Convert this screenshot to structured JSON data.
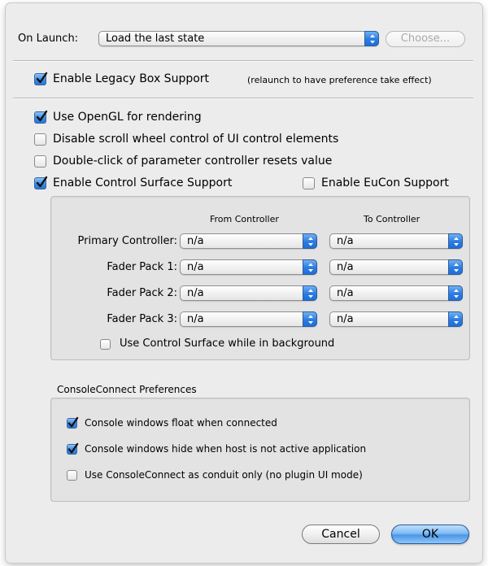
{
  "launch": {
    "label": "On Launch:",
    "selected": "Load the last state",
    "choose_label": "Choose..."
  },
  "legacy": {
    "label": "Enable Legacy Box Support",
    "note": "(relaunch to have preference take effect)",
    "checked": true
  },
  "options": [
    {
      "label": "Use OpenGL for rendering",
      "checked": true
    },
    {
      "label": "Disable scroll wheel control of UI control elements",
      "checked": false
    },
    {
      "label": "Double-click of parameter controller resets value",
      "checked": false
    },
    {
      "label": "Enable Control Surface Support",
      "checked": true
    }
  ],
  "eucon": {
    "label": "Enable EuCon Support",
    "checked": false
  },
  "controllers": {
    "from_header": "From Controller",
    "to_header": "To Controller",
    "rows": [
      {
        "label": "Primary Controller:",
        "from": "n/a",
        "to": "n/a"
      },
      {
        "label": "Fader Pack 1:",
        "from": "n/a",
        "to": "n/a"
      },
      {
        "label": "Fader Pack 2:",
        "from": "n/a",
        "to": "n/a"
      },
      {
        "label": "Fader Pack 3:",
        "from": "n/a",
        "to": "n/a"
      }
    ],
    "background_label": "Use Control Surface while in background",
    "background_checked": false
  },
  "console_connect": {
    "title": "ConsoleConnect Preferences",
    "items": [
      {
        "label": "Console windows float when connected",
        "checked": true
      },
      {
        "label": "Console windows hide when host is not active application",
        "checked": true
      },
      {
        "label": "Use ConsoleConnect as conduit only (no plugin UI mode)",
        "checked": false
      }
    ]
  },
  "buttons": {
    "cancel": "Cancel",
    "ok": "OK"
  },
  "colors": {
    "accent": "#3a8ae6",
    "window_bg": "#ececec"
  }
}
